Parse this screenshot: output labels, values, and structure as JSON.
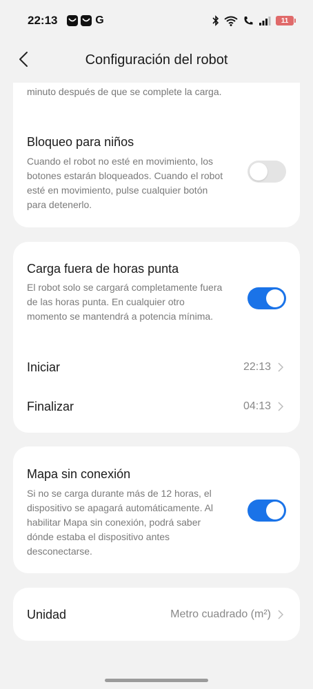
{
  "status_bar": {
    "time": "22:13",
    "app_icons": [
      "app-icon-1",
      "app-icon-2",
      "google-icon"
    ],
    "google_letter": "G",
    "battery": "11",
    "battery_color": "#e06a6a"
  },
  "header": {
    "title": "Configuración del robot",
    "back_icon": "chevron-left-icon"
  },
  "sections": {
    "overflow_text": "minuto después de que se complete la carga.",
    "child_lock": {
      "title": "Bloqueo para niños",
      "description": "Cuando el robot no esté en movimiento, los botones estarán bloqueados. Cuando el robot esté en movimiento, pulse cualquier botón para detenerlo.",
      "enabled": false
    },
    "off_peak": {
      "title": "Carga fuera de horas punta",
      "description": "El robot solo se cargará completamente fuera de las horas punta. En cualquier otro momento se mantendrá a potencia mínima.",
      "enabled": true,
      "start_label": "Iniciar",
      "start_value": "22:13",
      "end_label": "Finalizar",
      "end_value": "04:13"
    },
    "offline_map": {
      "title": "Mapa sin conexión",
      "description": "Si no se carga durante más de 12 horas, el dispositivo se apagará automáticamente. Al habilitar Mapa sin conexión, podrá saber dónde estaba el dispositivo antes desconectarse.",
      "enabled": true
    },
    "unit": {
      "label": "Unidad",
      "value": "Metro cuadrado (m²)"
    }
  },
  "colors": {
    "accent": "#1a73e8",
    "background": "#f2f2f2",
    "card": "#ffffff"
  }
}
